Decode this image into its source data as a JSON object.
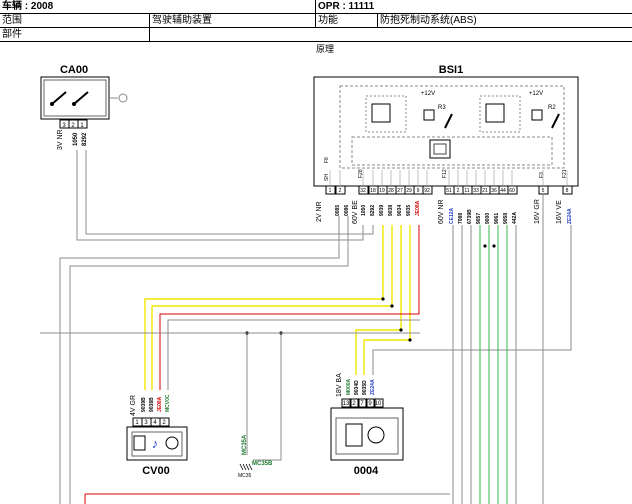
{
  "header": {
    "vehicle": "车辆 : 2008",
    "opr": "OPR : 11111",
    "scope_label": "范围",
    "scope_value": "驾驶辅助装置",
    "function_label": "功能",
    "function_value": "防抱死制动系统(ABS)",
    "part_label": "部件",
    "principle": "原理"
  },
  "components": {
    "ca00": {
      "name": "CA00",
      "connector_label": "3V NR",
      "pins": [
        "3",
        "2",
        "1"
      ],
      "wires": [
        "1050",
        "8292"
      ]
    },
    "bsi1": {
      "name": "BSI1",
      "supply_1": "+12V",
      "supply_2": "+12V",
      "relay_1": "R3",
      "relay_2": "R2",
      "fuses": [
        "F8",
        "F28",
        "F12",
        "F3",
        "F21"
      ],
      "bottom_left_tag": "SH",
      "pins": [
        "1",
        "2",
        "32",
        "18",
        "19",
        "28",
        "27",
        "29",
        "9",
        "92",
        "51",
        "2",
        "11",
        "33",
        "21",
        "36",
        "44",
        "60",
        "5",
        "8"
      ],
      "connectors": [
        {
          "label": "2V NR",
          "wires": [
            {
              "t": "0085",
              "c": "#000"
            },
            {
              "t": "0086",
              "c": "#000"
            }
          ]
        },
        {
          "label": "60V BE",
          "wires": [
            {
              "t": "1050",
              "c": "#000"
            },
            {
              "t": "8292",
              "c": "#000"
            },
            {
              "t": "9039",
              "c": "#000"
            },
            {
              "t": "9038",
              "c": "#000"
            },
            {
              "t": "9034",
              "c": "#000"
            },
            {
              "t": "9035",
              "c": "#000"
            },
            {
              "t": "JE08A",
              "c": "#d40000"
            }
          ]
        },
        {
          "label": "60V NR",
          "wires": [
            {
              "t": "CE12A",
              "c": "#1f3cc8"
            },
            {
              "t": "7088",
              "c": "#000"
            },
            {
              "t": "6739B",
              "c": "#000"
            },
            {
              "t": "9057",
              "c": "#000"
            },
            {
              "t": "9000",
              "c": "#000"
            },
            {
              "t": "9061",
              "c": "#000"
            },
            {
              "t": "9058",
              "c": "#000"
            },
            {
              "t": "442A",
              "c": "#000"
            }
          ]
        },
        {
          "label": "16V GR",
          "wires": []
        },
        {
          "label": "16V VE",
          "wires": [
            {
              "t": "ZE24A",
              "c": "#1f3cc8"
            }
          ]
        }
      ]
    },
    "cv00": {
      "name": "CV00",
      "connector_label": "4V GR",
      "pins": [
        "1",
        "3",
        "4",
        "2"
      ],
      "wires": [
        {
          "t": "9039B",
          "c": "#000"
        },
        {
          "t": "9038B",
          "c": "#000"
        },
        {
          "t": "JE08A",
          "c": "#d40000"
        },
        {
          "t": "MCV0C",
          "c": "#1e7a2e"
        }
      ]
    },
    "c0004": {
      "name": "0004",
      "connector_label": "18V BA",
      "pins": [
        "13",
        "2",
        "7",
        "9",
        "10"
      ],
      "wires": [
        {
          "t": "M000A",
          "c": "#1e7a2e"
        },
        {
          "t": "9034D",
          "c": "#000"
        },
        {
          "t": "9035D",
          "c": "#000"
        },
        {
          "t": "ZE24A",
          "c": "#1f3cc8"
        }
      ]
    },
    "ground": {
      "wire_a": "MC35A",
      "wire_b": "MC35B",
      "name": "MC35"
    }
  },
  "colors": {
    "yellow_wire": "#f2e600",
    "green_wire": "#39b54a",
    "red_wire": "#d40000",
    "blue_label": "#1f3cc8",
    "green_label": "#1e7a2e",
    "grey_wire": "#8c8c8c"
  }
}
